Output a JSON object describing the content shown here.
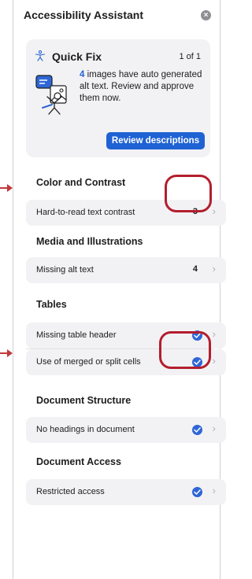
{
  "header": {
    "title": "Accessibility Assistant",
    "close_symbol": "×"
  },
  "quick_fix": {
    "title": "Quick Fix",
    "count": "1 of 1",
    "images_count": "4",
    "description": " images have auto generated alt text. Review and approve them now.",
    "button_label": "Review descriptions"
  },
  "sections": {
    "color_contrast": {
      "title": "Color and Contrast",
      "items": [
        {
          "label": "Hard-to-read text contrast",
          "count": "3"
        }
      ]
    },
    "media": {
      "title": "Media and Illustrations",
      "items": [
        {
          "label": "Missing alt text",
          "count": "4"
        }
      ]
    },
    "tables": {
      "title": "Tables",
      "items": [
        {
          "label": "Missing table header"
        },
        {
          "label": "Use of merged or split cells"
        }
      ]
    },
    "document_structure": {
      "title": "Document Structure",
      "items": [
        {
          "label": "No headings in document"
        }
      ]
    },
    "document_access": {
      "title": "Document Access",
      "items": [
        {
          "label": "Restricted access"
        }
      ]
    }
  },
  "chevron_symbol": "›",
  "colors": {
    "accent": "#1f62d4",
    "annotation": "#b41e2d"
  }
}
